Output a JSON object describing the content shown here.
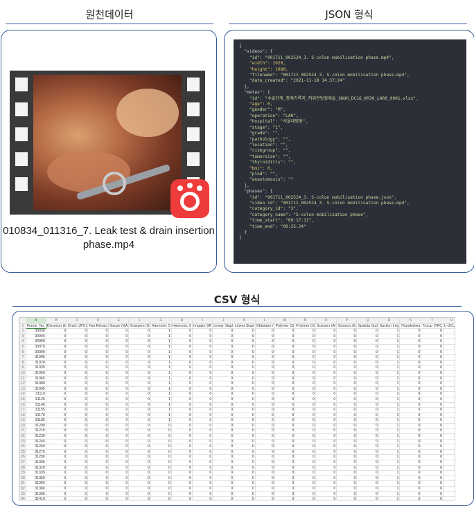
{
  "headings": {
    "raw_data": "원천데이터",
    "json_format": "JSON 형식",
    "csv_format": "CSV 형식"
  },
  "video": {
    "filename_line1": "010834_011316_7. Leak test & drain insertion",
    "filename_line2": "phase.mp4",
    "icon": "gom-player-icon",
    "icon_color": "#ee3b3b"
  },
  "json_lines": [
    "{",
    "  \"videos\": {",
    "    \"id\": \"001711_002524_3. S-colon mobilisation phase.mp4\",",
    "    \"width\": 1920,",
    "    \"height\": 1080,",
    "    \"filename\": \"001711_002524_3. S-colon mobilisation phase.mp4\",",
    "    \"date_created\": \"2021-11-18 14:37:24\"",
    "  },",
    "  \"metas\": {",
    "    \"id\": \"수술단계_증례기록지_저위전방절제술_SNUH_DC16_KM30_LAR0_0001.xlsx\",",
    "    \"age\": 0,",
    "    \"gender\": \"M\",",
    "    \"operation\": \"LAR\",",
    "    \"hospital\": \"서울대병원\",",
    "    \"stage\": \"1\",",
    "    \"grade\": \"\",",
    "    \"pathology\": \"\",",
    "    \"location\": \"\",",
    "    \"riskgroup\": \"\",",
    "    \"tumorsize\": \"\",",
    "    \"thyroiditis\": \"\",",
    "    \"bmi\": 0,",
    "    \"plnd\": \"\",",
    "    \"anastomosis\": \"\"",
    "  },",
    "  \"phases\": {",
    "    \"id\": \"001711_002524_3. S-colon mobilisation phase.json\",",
    "    \"video_id\": \"001711_002524_3. S-colon mobilisation phase.mp4\",",
    "    \"category_id\": \"3\",",
    "    \"category_name\": \"S-colon mobilisation phase\",",
    "    \"time_start\": \"00:17:11\",",
    "    \"time_end\": \"00:25:24\"",
    "  }",
    "}"
  ],
  "csv": {
    "column_letters": [
      "A",
      "B",
      "C",
      "D",
      "E",
      "F",
      "G",
      "H",
      "I",
      "J",
      "K",
      "L",
      "M",
      "N",
      "O",
      "P",
      "Q",
      "R",
      "S",
      "T",
      "U"
    ],
    "headers": [
      "Frame_No.",
      "Dissector (k",
      "Drain (JPC)",
      "Fan Retract",
      "Gauze (GA",
      "Graspers (G",
      "Harmonic S",
      "Harmonic S",
      "Irrigator (IR",
      "Linear Stapl",
      "Linear Stapl",
      "Obturator (",
      "Polymer Cli",
      "Polymer Cli",
      "Scissors (Al",
      "Scissors (E",
      "Spatula Sud",
      "Suction Irrig",
      "Thunderbea",
      "Trocar (TRC",
      "L-UCUK)"
    ],
    "frames": [
      "30930",
      "30945",
      "30960",
      "30975",
      "30990",
      "31005",
      "31020",
      "31035",
      "31050",
      "31065",
      "31080",
      "31095",
      "31110",
      "31125",
      "31140",
      "31155",
      "31170",
      "31185",
      "31200",
      "31215",
      "31230",
      "31245",
      "31260",
      "31275",
      "31290",
      "31305",
      "31320",
      "31335",
      "31350",
      "31365",
      "31380",
      "31395",
      "31410",
      "31425",
      "31440",
      "31455"
    ],
    "ones": {
      "graspers": [
        0,
        1,
        2,
        3,
        4,
        5,
        6,
        7,
        8,
        9,
        10,
        11,
        12,
        13,
        14,
        15,
        16,
        17
      ],
      "spatula": [
        0,
        1,
        2,
        3,
        4,
        5,
        6,
        7,
        8,
        9,
        10,
        11,
        12,
        13,
        14,
        15,
        16,
        17,
        18,
        19,
        20,
        21,
        22,
        23,
        24,
        25,
        26,
        27,
        28,
        29,
        30,
        31,
        32,
        33,
        34
      ]
    }
  }
}
